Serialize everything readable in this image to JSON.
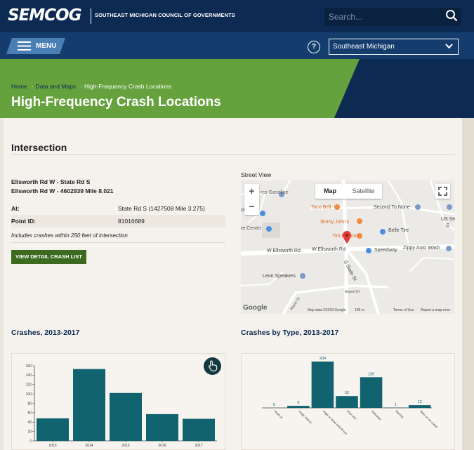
{
  "header": {
    "logo": "SEMCOG",
    "logo_subtitle": "SOUTHEAST MICHIGAN COUNCIL OF GOVERNMENTS",
    "search_placeholder": "Search..."
  },
  "nav": {
    "menu_label": "MENU",
    "help_symbol": "?",
    "region": "Southeast Michigan"
  },
  "breadcrumb": [
    "Home",
    "Data and Maps",
    "High-Frequency Crash Locations"
  ],
  "page_title": "High-Frequency Crash Locations",
  "intersection": {
    "section_title": "Intersection",
    "name_line1": "Ellsworth Rd W - State Rd S",
    "name_line2": "Ellsworth Rd W - 4602939 Mile 8.021",
    "rows": [
      {
        "key": "At:",
        "value": "State Rd S (1427508 Mile 3.275)"
      },
      {
        "key": "Point ID:",
        "value": "81016689"
      }
    ],
    "note": "Includes crashes within 250 feet of intersection",
    "button_label": "VIEW DETAIL CRASH LIST"
  },
  "map": {
    "street_view_label": "Street View",
    "type_map": "Map",
    "type_satellite": "Satellite",
    "zoom_in": "+",
    "zoom_out": "−",
    "labels": {
      "gasoline": "rco Gasoline",
      "taco_bell": "Taco Bell",
      "second_to_none": "Second To None",
      "us_sec": "US Se",
      "us_sec2": "S",
      "jimmy_johns": "Jimmy John's",
      "center": "re Center",
      "belle_tire": "Belle Tire",
      "tim_hortons": "Tim Hortons",
      "ellsworth1": "W Ellsworth Rd",
      "ellsworth2": "W Ellsworth Rd",
      "speedway": "Speedway",
      "zippy": "Zippy Auto Wash",
      "state_st": "S State St",
      "leon": "Leon Speakers",
      "airport_dr": "Airport Dr",
      "airport_dr2": "Airport Dr",
      "olesale": "olesale"
    },
    "google": "Google",
    "map_data": "Map data ©2019 Google",
    "scale": "100 m",
    "terms": "Terms of Use",
    "report": "Report a map error"
  },
  "charts": {
    "crashes_title": "Crashes, 2013-2017",
    "by_type_title": "Crashes by Type, 2013-2017"
  },
  "chart_data": [
    {
      "type": "bar",
      "title": "Crashes, 2013-2017",
      "categories": [
        "2013",
        "2014",
        "2015",
        "2016",
        "2017"
      ],
      "values": [
        48,
        153,
        102,
        57,
        47
      ],
      "ylim": [
        0,
        160
      ],
      "yticks": [
        0,
        20,
        40,
        60,
        80,
        100,
        120,
        140,
        160
      ],
      "color": "#11646f"
    },
    {
      "type": "bar",
      "title": "Crashes by Type, 2013-2017",
      "categories": [
        "Head-on",
        "Single Vehicle",
        "Angle or Head-on/Left-turn",
        "Rear-end",
        "Sideswipe",
        "Backing",
        "Other or not coded"
      ],
      "values": [
        0,
        9,
        204,
        52,
        135,
        1,
        12
      ],
      "data_labels": [
        "0",
        "9",
        "204",
        "52",
        "135",
        "1",
        "12"
      ],
      "color": "#11646f",
      "label_color": "#11646f"
    }
  ],
  "colors": {
    "navy": "#0c2a52",
    "green": "#65a23d",
    "teal": "#11646f",
    "button_green": "#3c6b20"
  }
}
